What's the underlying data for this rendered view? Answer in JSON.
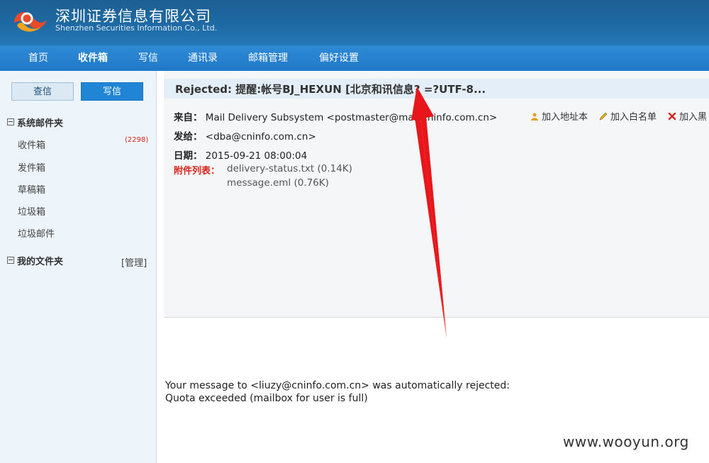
{
  "header": {
    "company_cn": "深圳证券信息有限公司",
    "company_en": "Shenzhen Securities Information Co., Ltd."
  },
  "nav": {
    "items": [
      "首页",
      "收件箱",
      "写信",
      "通讯录",
      "邮箱管理",
      "偏好设置"
    ],
    "active": "收件箱"
  },
  "sidebar": {
    "check_btn": "查信",
    "write_btn": "写信",
    "system_folder": "系统邮件夹",
    "folders": [
      {
        "label": "收件箱",
        "count": "(2298)"
      },
      {
        "label": "发件箱"
      },
      {
        "label": "草稿箱"
      },
      {
        "label": "垃圾箱"
      },
      {
        "label": "垃圾邮件"
      }
    ],
    "my_folder": "我的文件夹",
    "manage": "[管理]"
  },
  "mail": {
    "subject": "Rejected: 提醒:帐号BJ_HEXUN [北京和讯信息? =?UTF-8...",
    "from_label": "来自：",
    "from_value": "Mail Delivery Subsystem <postmaster@mail.cninfo.com.cn>",
    "to_label": "发给：",
    "to_value": "<dba@cninfo.com.cn>",
    "date_label": "日期：",
    "date_value": "2015-09-21 08:00:04",
    "attach_label": "附件列表：",
    "attachments": [
      "delivery-status.txt (0.14K)",
      "message.eml (0.76K)"
    ],
    "actions": [
      "加入地址本",
      "加入白名单",
      "加入黑"
    ],
    "body_line1": "Your message to <liuzy@cninfo.com.cn> was automatically rejected:",
    "body_line2": "Quota exceeded (mailbox for user is full)"
  },
  "watermark": "www.wooyun.org",
  "colors": {
    "header_bg": "#1f6ba5",
    "nav_bg": "#2482cf",
    "sidebar_bg": "#edf4fa",
    "accent_red": "#d9251c",
    "arrow": "#e8161b"
  },
  "icons": [
    "logo-icon",
    "address-book-icon",
    "whitelist-pencil-icon",
    "blacklist-x-icon"
  ]
}
